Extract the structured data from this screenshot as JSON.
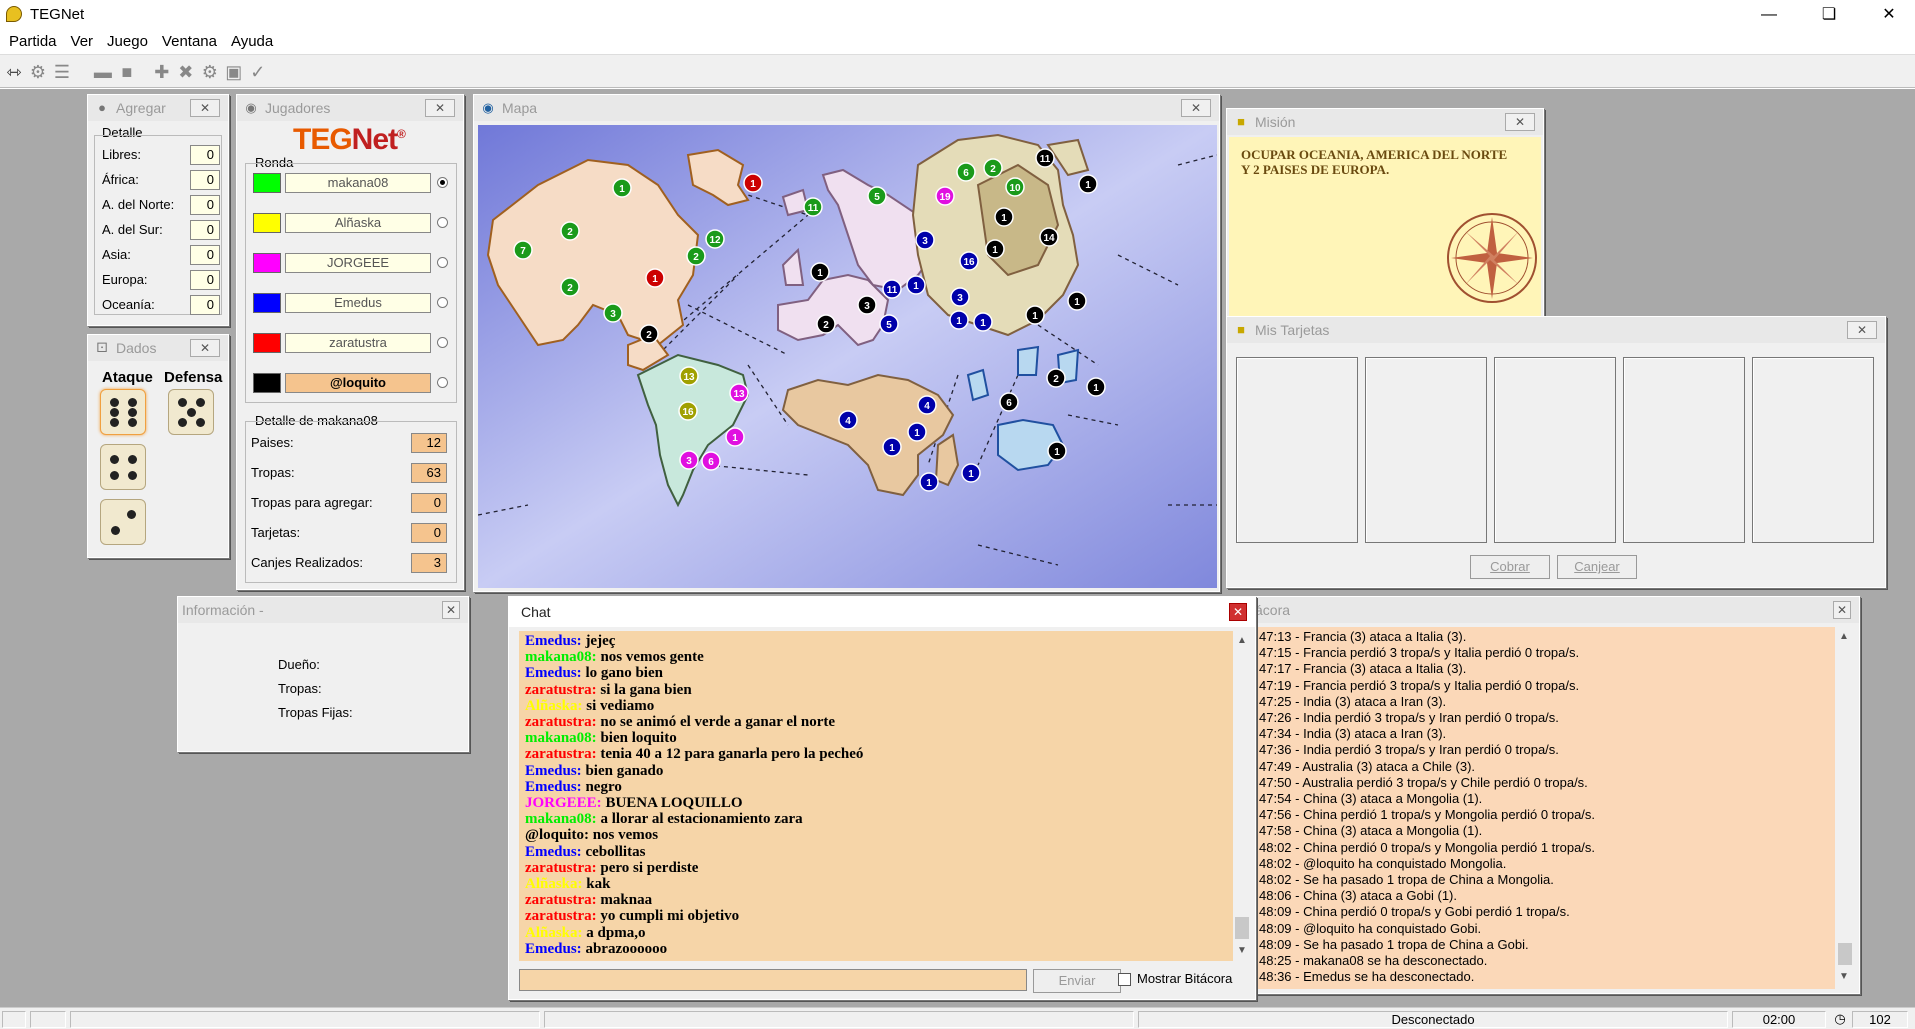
{
  "app": {
    "title": "TEGNet"
  },
  "menu": [
    "Partida",
    "Ver",
    "Juego",
    "Ventana",
    "Ayuda"
  ],
  "agregar": {
    "title": "Agregar",
    "group": "Detalle",
    "rows": [
      {
        "label": "Libres:",
        "value": "0"
      },
      {
        "label": "África:",
        "value": "0"
      },
      {
        "label": "A. del Norte:",
        "value": "0"
      },
      {
        "label": "A. del Sur:",
        "value": "0"
      },
      {
        "label": "Asia:",
        "value": "0"
      },
      {
        "label": "Europa:",
        "value": "0"
      },
      {
        "label": "Oceanía:",
        "value": "0"
      }
    ]
  },
  "dados": {
    "title": "Dados",
    "attack": "Ataque",
    "defense": "Defensa"
  },
  "jugadores": {
    "title": "Jugadores",
    "logo_a": "TEG",
    "logo_b": "Net",
    "logo_reg": "®",
    "ronda": "Ronda",
    "players": [
      {
        "name": "makana08",
        "color": "#00ff00",
        "selected": true
      },
      {
        "name": "Alñaska",
        "color": "#ffff00",
        "selected": false
      },
      {
        "name": "JORGEEE",
        "color": "#ff00ff",
        "selected": false
      },
      {
        "name": "Emedus",
        "color": "#0000ff",
        "selected": false
      },
      {
        "name": "zaratustra",
        "color": "#ff0000",
        "selected": false
      },
      {
        "name": "@loquito",
        "color": "#000000",
        "selected": false
      }
    ],
    "detail_title": "Detalle de makana08",
    "detail": [
      {
        "label": "Paises:",
        "value": "12"
      },
      {
        "label": "Tropas:",
        "value": "63"
      },
      {
        "label": "Tropas para agregar:",
        "value": "0"
      },
      {
        "label": "Tarjetas:",
        "value": "0"
      },
      {
        "label": "Canjes Realizados:",
        "value": "3"
      }
    ]
  },
  "mapa": {
    "title": "Mapa"
  },
  "mision": {
    "title": "Misión",
    "text": "OCUPAR OCEANIA, AMERICA DEL NORTE Y 2 PAISES DE EUROPA."
  },
  "tarjetas": {
    "title": "Mis Tarjetas",
    "cobrar": "Cobrar",
    "canjear": "Canjear"
  },
  "info": {
    "title": "Información -",
    "dueno": "Dueño:",
    "tropas": "Tropas:",
    "fijas": "Tropas Fijas:"
  },
  "chat": {
    "title": "Chat",
    "send": "Enviar",
    "show_log": "Mostrar Bitácora",
    "lines": [
      {
        "n": "Emedus:",
        "t": " jejeç",
        "c": "#0000ff"
      },
      {
        "n": "makana08:",
        "t": " nos vemos gente",
        "c": "#00ee00"
      },
      {
        "n": "Emedus:",
        "t": " lo gano bien",
        "c": "#0000ff"
      },
      {
        "n": "zaratustra:",
        "t": " si la gana bien",
        "c": "#ff0000"
      },
      {
        "n": "Alñaska:",
        "t": " si vediamo",
        "c": "#ffff00"
      },
      {
        "n": "zaratustra:",
        "t": " no se animó el verde a ganar el norte",
        "c": "#ff0000"
      },
      {
        "n": "makana08:",
        "t": " bien loquito",
        "c": "#00ee00"
      },
      {
        "n": "zaratustra:",
        "t": " tenia 40 a 12 para ganarla pero la pecheó",
        "c": "#ff0000"
      },
      {
        "n": "Emedus:",
        "t": " bien ganado",
        "c": "#0000ff"
      },
      {
        "n": "Emedus:",
        "t": " negro",
        "c": "#0000ff"
      },
      {
        "n": "JORGEEE:",
        "t": " BUENA LOQUILLO",
        "c": "#ff00ff"
      },
      {
        "n": "makana08:",
        "t": " a llorar al estacionamiento zara",
        "c": "#00ee00"
      },
      {
        "n": "@loquito:",
        "t": " nos vemos",
        "c": "#000000"
      },
      {
        "n": "Emedus:",
        "t": " cebollitas",
        "c": "#0000ff"
      },
      {
        "n": "zaratustra:",
        "t": " pero si perdiste",
        "c": "#ff0000"
      },
      {
        "n": "Alñaska:",
        "t": " kak",
        "c": "#ffff00"
      },
      {
        "n": "zaratustra:",
        "t": " maknaa",
        "c": "#ff0000"
      },
      {
        "n": "zaratustra:",
        "t": " yo cumpli mi objetivo",
        "c": "#ff0000"
      },
      {
        "n": "Alñaska:",
        "t": " a dpma,o",
        "c": "#ffff00"
      },
      {
        "n": "Emedus:",
        "t": " abrazoooooo",
        "c": "#0000ff"
      }
    ]
  },
  "bitacora": {
    "title": "ácora",
    "lines": [
      "47:13 - Francia (3) ataca a Italia (3).",
      "47:15 - Francia perdió 3 tropa/s y Italia perdió 0 tropa/s.",
      "47:17 - Francia (3) ataca a Italia (3).",
      "47:19 - Francia perdió 3 tropa/s y Italia perdió 0 tropa/s.",
      "47:25 - India (3) ataca a Iran (3).",
      "47:26 - India perdió 3 tropa/s y Iran perdió 0 tropa/s.",
      "47:34 - India (3) ataca a Iran (3).",
      "47:36 - India perdió 3 tropa/s y Iran perdió 0 tropa/s.",
      "47:49 - Australia (3) ataca a Chile (3).",
      "47:50 - Australia perdió 3 tropa/s y Chile perdió 0 tropa/s.",
      "47:54 - China (3) ataca a Mongolia (1).",
      "47:56 - China perdió 1 tropa/s y Mongolia perdió 0 tropa/s.",
      "47:58 - China (3) ataca a Mongolia (1).",
      "48:02 - China perdió 0 tropa/s y Mongolia perdió 1 tropa/s.",
      "48:02 - @loquito ha conquistado Mongolia.",
      "48:02 - Se ha pasado 1 tropa de China a Mongolia.",
      "48:06 - China (3) ataca a Gobi (1).",
      "48:09 - China perdió 0 tropa/s y Gobi perdió 1 tropa/s.",
      "48:09 - @loquito ha conquistado Gobi.",
      "48:09 - Se ha pasado 1 tropa de China a Gobi.",
      "48:25 - makana08 se ha desconectado.",
      "48:36 - Emedus se ha desconectado."
    ]
  },
  "status": {
    "conn": "Desconectado",
    "time": "02:00",
    "count": "102"
  },
  "map_armies": [
    {
      "n": "1",
      "c": "#1a9a1a"
    },
    {
      "n": "2",
      "c": "#1a9a1a"
    },
    {
      "n": "7",
      "c": "#1a9a1a"
    },
    {
      "n": "12",
      "c": "#1a9a1a"
    },
    {
      "n": "2",
      "c": "#1a9a1a"
    },
    {
      "n": "2",
      "c": "#1a9a1a"
    },
    {
      "n": "3",
      "c": "#1a9a1a"
    },
    {
      "n": "1",
      "c": "#cc0000"
    },
    {
      "n": "1",
      "c": "#cc0000"
    },
    {
      "n": "2",
      "c": "#000000"
    },
    {
      "n": "11",
      "c": "#1a9a1a"
    },
    {
      "n": "5",
      "c": "#1a9a1a"
    },
    {
      "n": "1",
      "c": "#000000"
    },
    {
      "n": "6",
      "c": "#1a9a1a"
    },
    {
      "n": "2",
      "c": "#1a9a1a"
    },
    {
      "n": "10",
      "c": "#1a9a1a"
    },
    {
      "n": "11",
      "c": "#000000"
    },
    {
      "n": "1",
      "c": "#000000"
    },
    {
      "n": "19",
      "c": "#e010e0"
    },
    {
      "n": "1",
      "c": "#000000"
    },
    {
      "n": "3",
      "c": "#0000aa"
    },
    {
      "n": "1",
      "c": "#000000"
    },
    {
      "n": "14",
      "c": "#000000"
    },
    {
      "n": "16",
      "c": "#0000aa"
    },
    {
      "n": "3",
      "c": "#000000"
    },
    {
      "n": "11",
      "c": "#0000aa"
    },
    {
      "n": "1",
      "c": "#0000aa"
    },
    {
      "n": "3",
      "c": "#0000aa"
    },
    {
      "n": "2",
      "c": "#000000"
    },
    {
      "n": "5",
      "c": "#0000aa"
    },
    {
      "n": "1",
      "c": "#0000aa"
    },
    {
      "n": "1",
      "c": "#0000aa"
    },
    {
      "n": "1",
      "c": "#000000"
    },
    {
      "n": "1",
      "c": "#000000"
    },
    {
      "n": "13",
      "c": "#a0a000"
    },
    {
      "n": "13",
      "c": "#e010e0"
    },
    {
      "n": "16",
      "c": "#a0a000"
    },
    {
      "n": "1",
      "c": "#e010e0"
    },
    {
      "n": "3",
      "c": "#e010e0"
    },
    {
      "n": "6",
      "c": "#e010e0"
    },
    {
      "n": "4",
      "c": "#0000aa"
    },
    {
      "n": "4",
      "c": "#0000aa"
    },
    {
      "n": "1",
      "c": "#0000aa"
    },
    {
      "n": "1",
      "c": "#0000aa"
    },
    {
      "n": "1",
      "c": "#0000aa"
    },
    {
      "n": "1",
      "c": "#0000aa"
    },
    {
      "n": "6",
      "c": "#000000"
    },
    {
      "n": "2",
      "c": "#000000"
    },
    {
      "n": "1",
      "c": "#000000"
    },
    {
      "n": "1",
      "c": "#000000"
    }
  ]
}
